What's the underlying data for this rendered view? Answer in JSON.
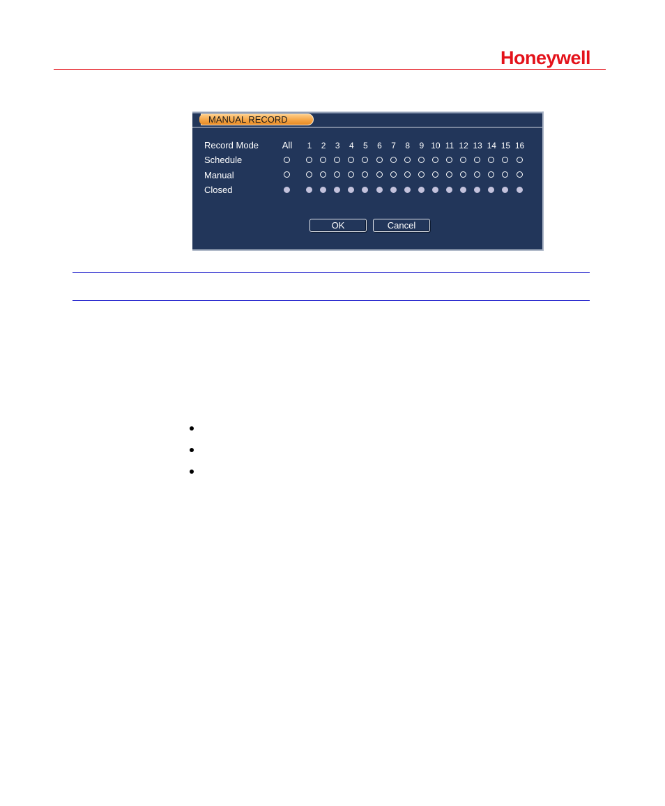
{
  "page": {
    "brand": "Honeywell",
    "brand_color": "#e4121a",
    "rule_color": "#1010c8",
    "bullets": [
      "",
      "",
      ""
    ]
  },
  "dialog": {
    "title": "MANUAL RECORD",
    "header_label": "Record Mode",
    "all_label": "All",
    "channels": [
      "1",
      "2",
      "3",
      "4",
      "5",
      "6",
      "7",
      "8",
      "9",
      "10",
      "11",
      "12",
      "13",
      "14",
      "15",
      "16"
    ],
    "rows": [
      {
        "label": "Schedule",
        "all_selected": false,
        "selected": [
          false,
          false,
          false,
          false,
          false,
          false,
          false,
          false,
          false,
          false,
          false,
          false,
          false,
          false,
          false,
          false
        ]
      },
      {
        "label": "Manual",
        "all_selected": false,
        "selected": [
          false,
          false,
          false,
          false,
          false,
          false,
          false,
          false,
          false,
          false,
          false,
          false,
          false,
          false,
          false,
          false
        ]
      },
      {
        "label": "Closed",
        "all_selected": true,
        "selected": [
          true,
          true,
          true,
          true,
          true,
          true,
          true,
          true,
          true,
          true,
          true,
          true,
          true,
          true,
          true,
          true
        ]
      }
    ],
    "ok_label": "OK",
    "cancel_label": "Cancel",
    "colors": {
      "background": "#22365a",
      "title_tab": "#f5a546",
      "selected_radio": "#c3c2dc"
    }
  }
}
